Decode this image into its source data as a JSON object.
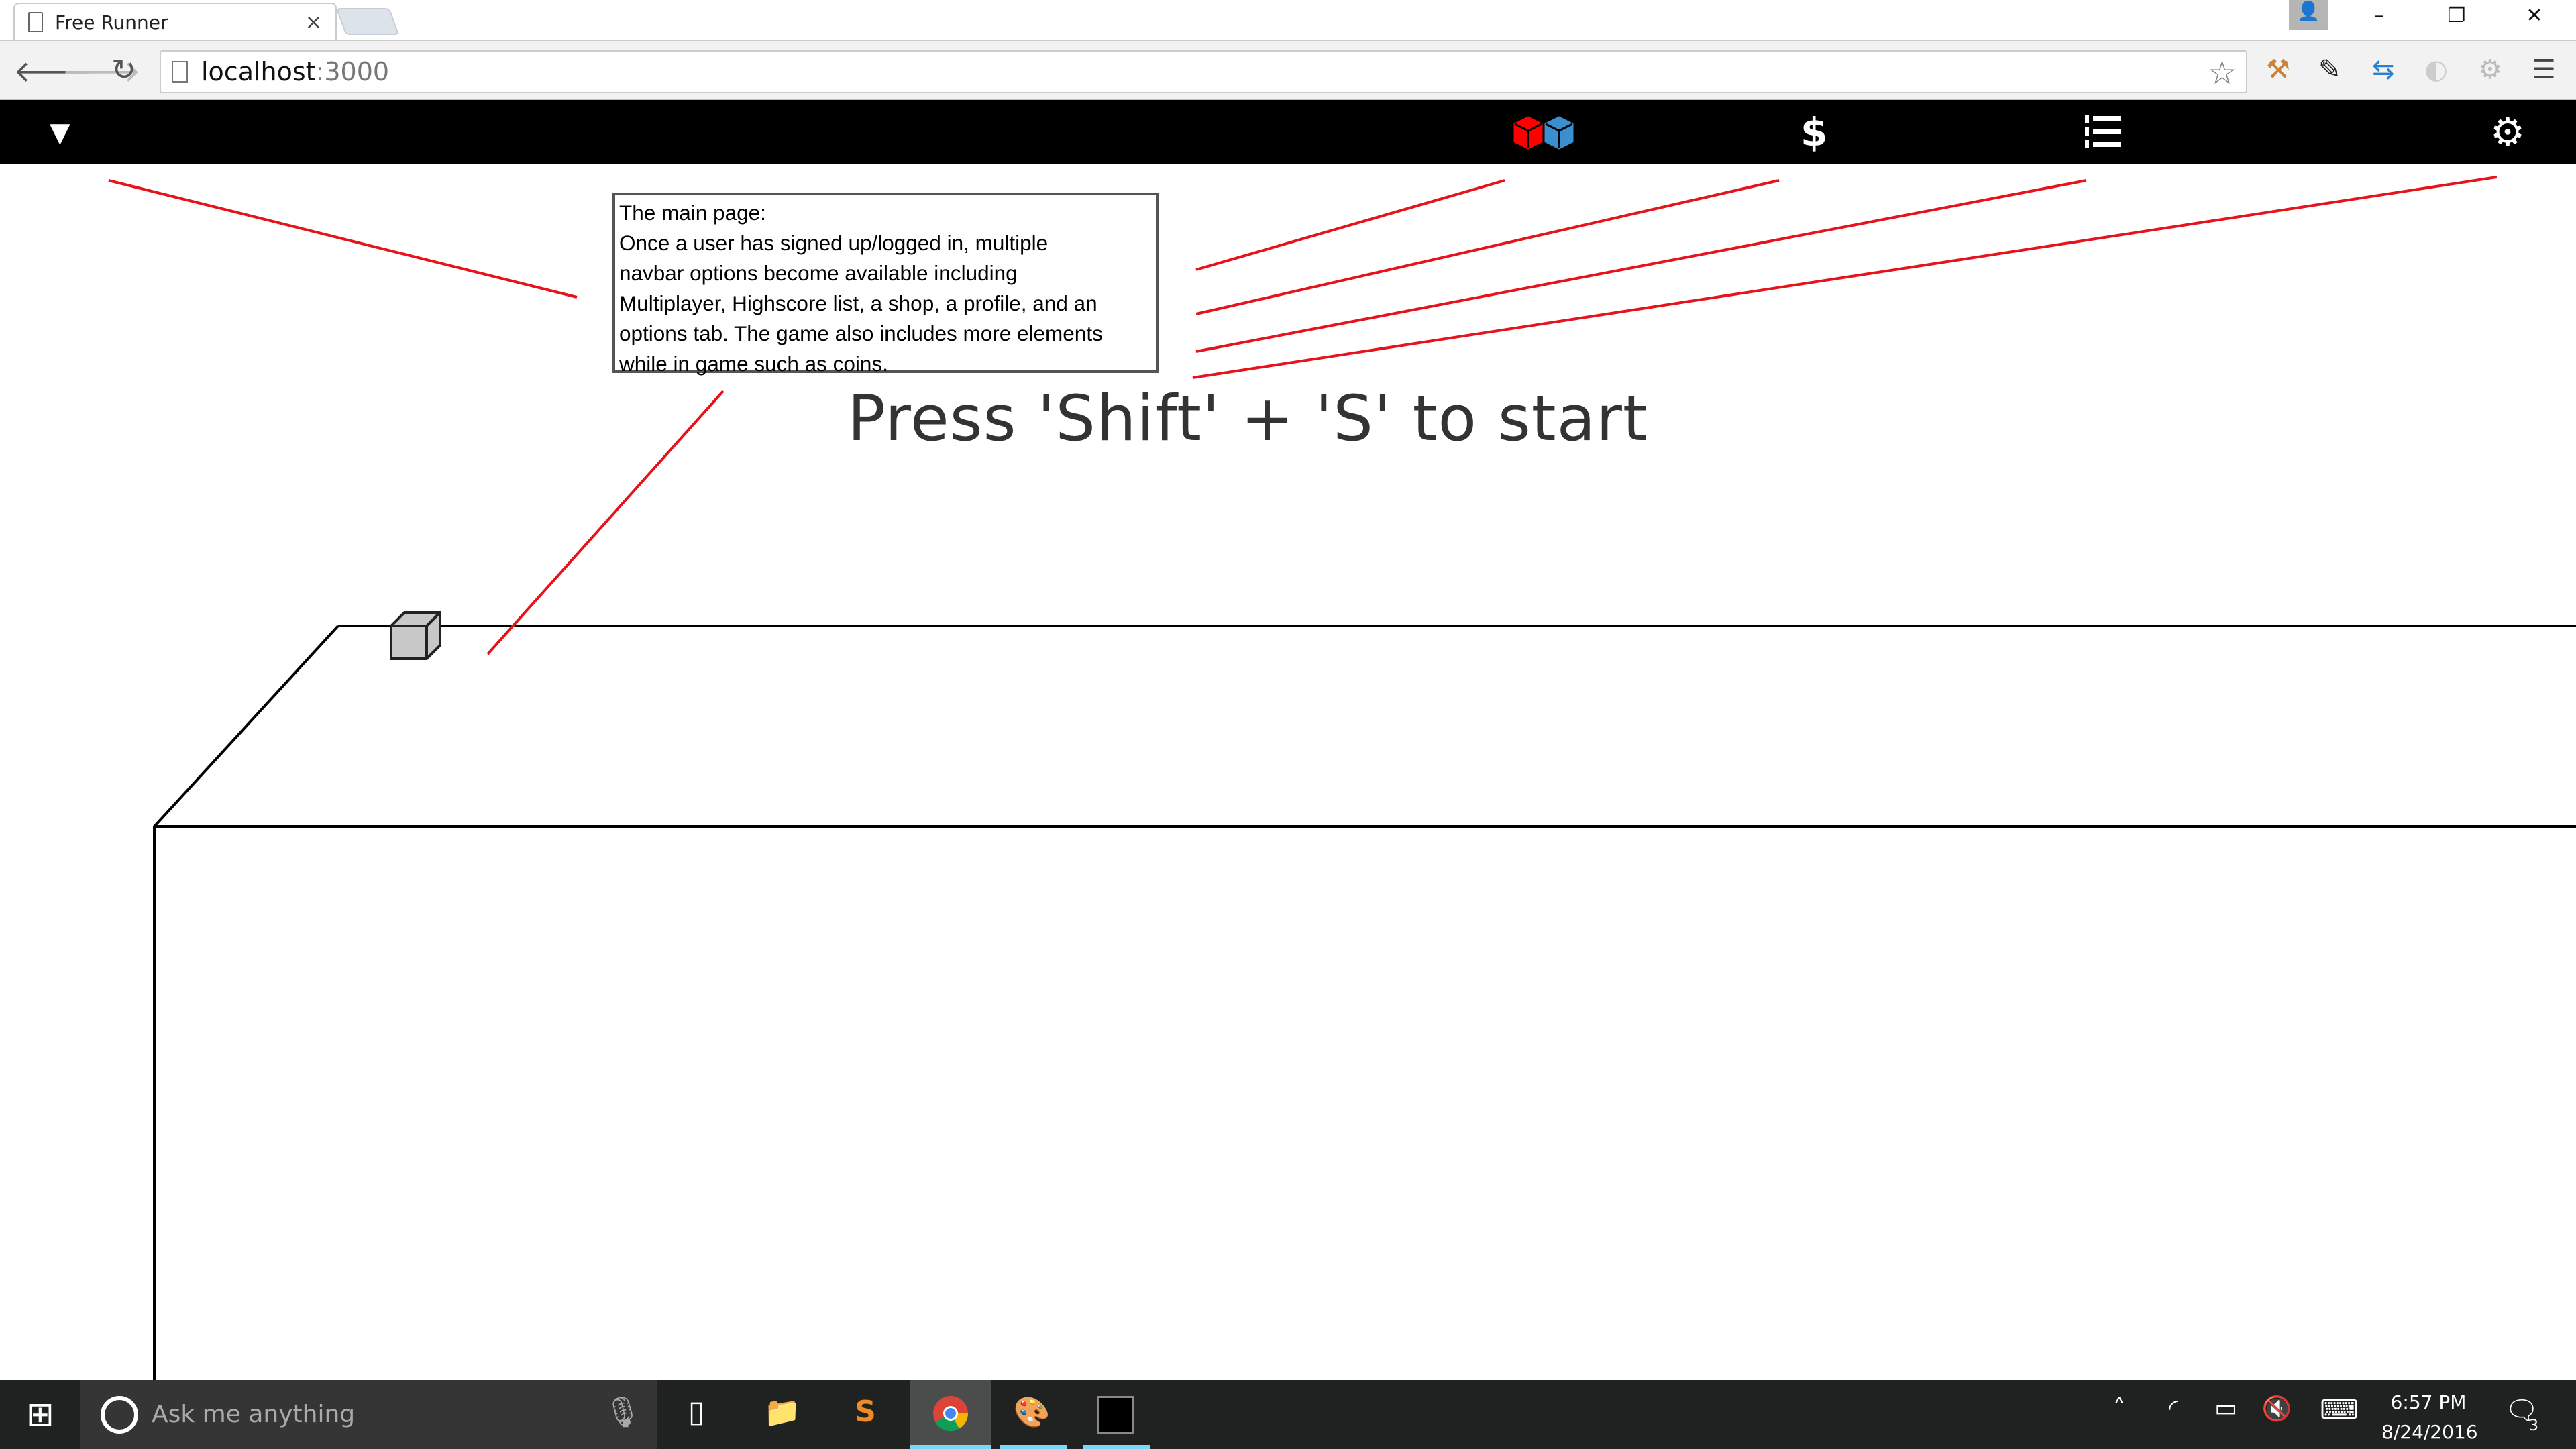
{
  "browser": {
    "tab_title": "Free Runner",
    "tab_close": "×",
    "url_host": "localhost",
    "url_port": ":3000",
    "window_controls": {
      "minimize": "–",
      "restore": "❐",
      "close": "✕"
    }
  },
  "navbar": {
    "icons": [
      "caret-down-icon",
      "multiplayer-cubes-icon",
      "dollar-icon",
      "highscore-list-icon",
      "gear-icon"
    ],
    "dollar": "$",
    "colors": {
      "cube_red": "#ff0000",
      "cube_blue": "#3a8fd0",
      "bar": "#000000"
    }
  },
  "annotation": {
    "lines": [
      "The main page:",
      "Once a user has signed up/logged in, multiple",
      "navbar options become available including",
      "Multiplayer, Highscore list, a shop, a profile, and an",
      "options tab. The game also includes more elements",
      "while in game such as coins."
    ],
    "line_color": "#e8121a"
  },
  "game": {
    "start_prompt": "Press 'Shift' + 'S' to start"
  },
  "taskbar": {
    "search_placeholder": "Ask me anything",
    "time": "6:57 PM",
    "date": "8/24/2016",
    "notification_count": "3"
  }
}
